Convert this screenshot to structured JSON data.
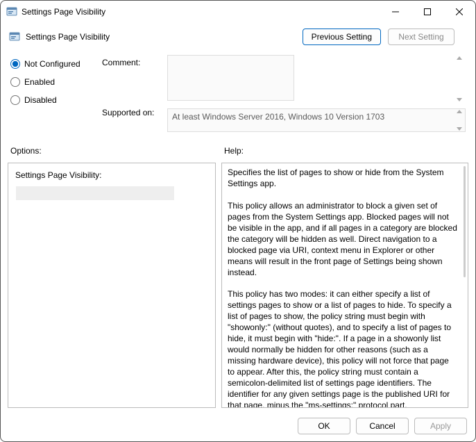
{
  "window": {
    "title": "Settings Page Visibility"
  },
  "header": {
    "policy_title": "Settings Page Visibility",
    "previous_label": "Previous Setting",
    "next_label": "Next Setting"
  },
  "state": {
    "selected": "not_configured",
    "radios": {
      "not_configured": "Not Configured",
      "enabled": "Enabled",
      "disabled": "Disabled"
    }
  },
  "labels": {
    "comment": "Comment:",
    "supported": "Supported on:",
    "options": "Options:",
    "help": "Help:"
  },
  "fields": {
    "comment_value": "",
    "supported_value": "At least Windows Server 2016, Windows 10 Version 1703"
  },
  "options_panel": {
    "field_label": "Settings Page Visibility:",
    "field_value": ""
  },
  "help_text": "Specifies the list of pages to show or hide from the System Settings app.\n\nThis policy allows an administrator to block a given set of pages from the System Settings app. Blocked pages will not be visible in the app, and if all pages in a category are blocked the category will be hidden as well. Direct navigation to a blocked page via URI, context menu in Explorer or other means will result in the front page of Settings being shown instead.\n\nThis policy has two modes: it can either specify a list of settings pages to show or a list of pages to hide. To specify a list of pages to show, the policy string must begin with \"showonly:\" (without quotes), and to specify a list of pages to hide, it must begin with \"hide:\". If a page in a showonly list would normally be hidden for other reasons (such as a missing hardware device), this policy will not force that page to appear. After this, the policy string must contain a semicolon-delimited list of settings page identifiers. The identifier for any given settings page is the published URI for that page, minus the \"ms-settings:\" protocol part.",
  "footer": {
    "ok": "OK",
    "cancel": "Cancel",
    "apply": "Apply"
  }
}
